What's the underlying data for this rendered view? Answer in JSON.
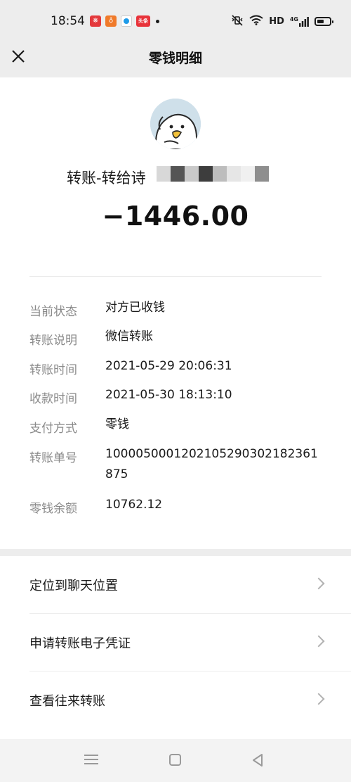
{
  "status_bar": {
    "time": "18:54",
    "notif_icons": [
      "app-icon-1",
      "app-icon-2",
      "app-icon-3",
      "toutiao-icon"
    ],
    "notif_4_text": "头条",
    "network": "HD",
    "signal": "4G"
  },
  "nav": {
    "title": "零钱明细",
    "close_icon": "close-icon"
  },
  "transfer": {
    "title": "转账-转给诗",
    "amount": "−1446.00"
  },
  "details": [
    {
      "label": "当前状态",
      "value": "对方已收钱"
    },
    {
      "label": "转账说明",
      "value": "微信转账"
    },
    {
      "label": "转账时间",
      "value": "2021-05-29 20:06:31"
    },
    {
      "label": "收款时间",
      "value": "2021-05-30 18:13:10"
    },
    {
      "label": "支付方式",
      "value": "零钱"
    },
    {
      "label": "转账单号",
      "value": "1000050001202105290302182361875"
    },
    {
      "label": "零钱余额",
      "value": "10762.12"
    }
  ],
  "actions": [
    {
      "label": "定位到聊天位置"
    },
    {
      "label": "申请转账电子凭证"
    },
    {
      "label": "查看往来转账"
    }
  ],
  "colors": {
    "background": "#ededed",
    "card": "#ffffff",
    "label_gray": "#8a8a8a",
    "text": "#1a1a1a"
  }
}
